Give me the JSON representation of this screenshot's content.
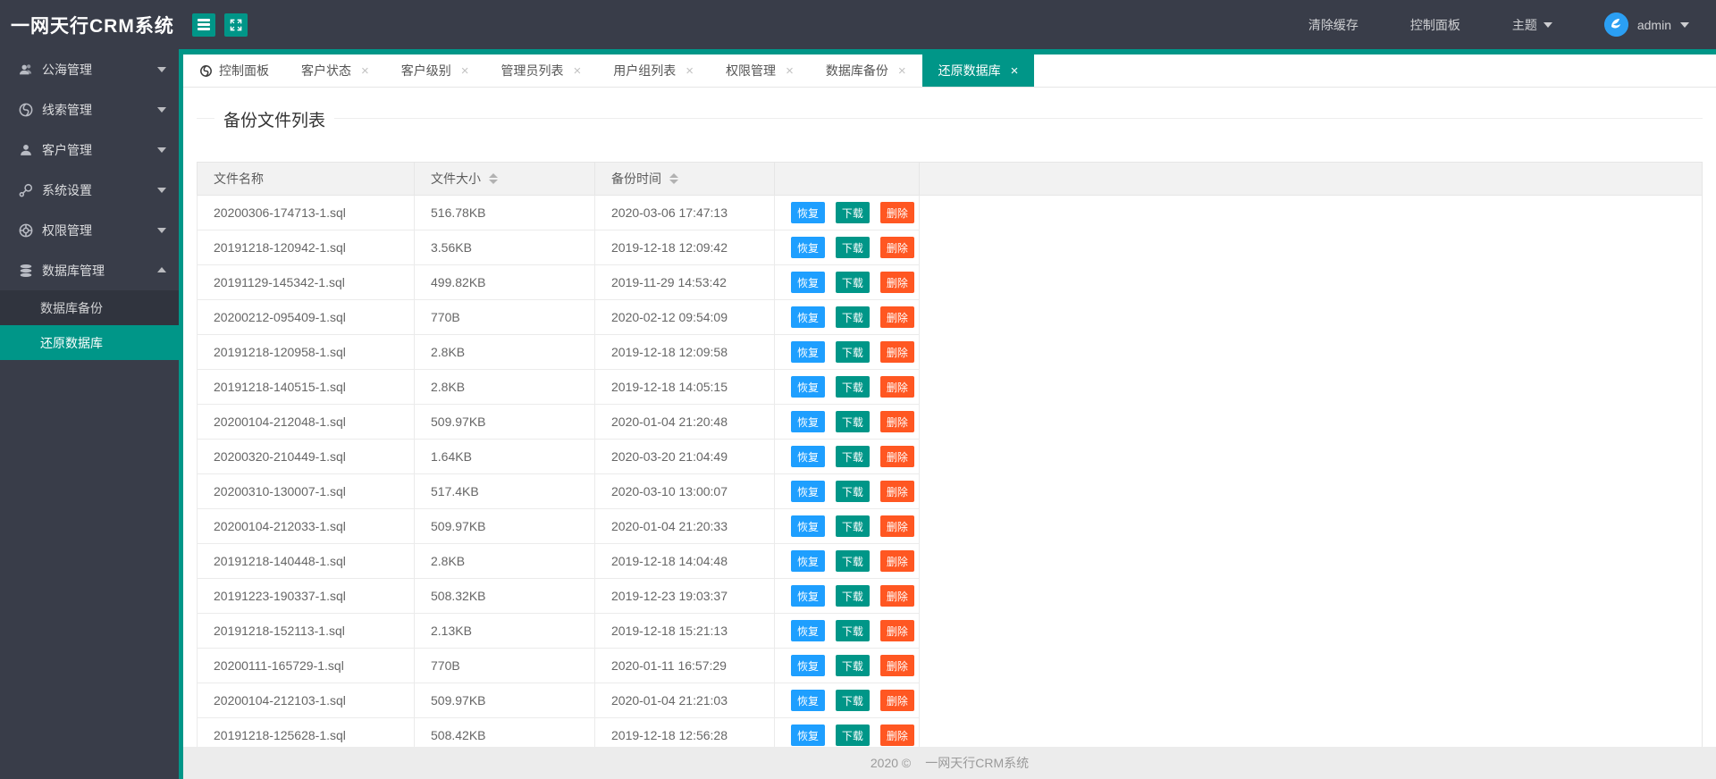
{
  "app": {
    "title": "一网天行CRM系统"
  },
  "header": {
    "menu_items": [
      "清除缓存",
      "控制面板"
    ],
    "theme_label": "主题",
    "username": "admin"
  },
  "sidebar": {
    "items": [
      {
        "label": "公海管理",
        "icon": "users-icon",
        "expanded": false
      },
      {
        "label": "线索管理",
        "icon": "globe-icon",
        "expanded": false
      },
      {
        "label": "客户管理",
        "icon": "user-icon",
        "expanded": false
      },
      {
        "label": "系统设置",
        "icon": "settings-icon",
        "expanded": false
      },
      {
        "label": "权限管理",
        "icon": "wheel-icon",
        "expanded": false
      },
      {
        "label": "数据库管理",
        "icon": "database-icon",
        "expanded": true,
        "children": [
          {
            "label": "数据库备份",
            "active": false
          },
          {
            "label": "还原数据库",
            "active": true
          }
        ]
      }
    ]
  },
  "tabs": [
    {
      "label": "控制面板",
      "has_icon": true,
      "closable": false,
      "active": false
    },
    {
      "label": "客户状态",
      "closable": true,
      "active": false
    },
    {
      "label": "客户级别",
      "closable": true,
      "active": false
    },
    {
      "label": "管理员列表",
      "closable": true,
      "active": false
    },
    {
      "label": "用户组列表",
      "closable": true,
      "active": false
    },
    {
      "label": "权限管理",
      "closable": true,
      "active": false
    },
    {
      "label": "数据库备份",
      "closable": true,
      "active": false
    },
    {
      "label": "还原数据库",
      "closable": true,
      "active": true
    }
  ],
  "page": {
    "section_title": "备份文件列表",
    "table": {
      "columns": [
        {
          "label": "文件名称",
          "sortable": false
        },
        {
          "label": "文件大小",
          "sortable": true
        },
        {
          "label": "备份时间",
          "sortable": true
        },
        {
          "label": "",
          "sortable": false
        }
      ],
      "row_actions": [
        {
          "label": "恢复",
          "color": "#1E9FFF"
        },
        {
          "label": "下载",
          "color": "#009688"
        },
        {
          "label": "删除",
          "color": "#FF5722"
        }
      ],
      "rows": [
        {
          "name": "20200306-174713-1.sql",
          "size": "516.78KB",
          "time": "2020-03-06 17:47:13"
        },
        {
          "name": "20191218-120942-1.sql",
          "size": "3.56KB",
          "time": "2019-12-18 12:09:42"
        },
        {
          "name": "20191129-145342-1.sql",
          "size": "499.82KB",
          "time": "2019-11-29 14:53:42"
        },
        {
          "name": "20200212-095409-1.sql",
          "size": "770B",
          "time": "2020-02-12 09:54:09"
        },
        {
          "name": "20191218-120958-1.sql",
          "size": "2.8KB",
          "time": "2019-12-18 12:09:58"
        },
        {
          "name": "20191218-140515-1.sql",
          "size": "2.8KB",
          "time": "2019-12-18 14:05:15"
        },
        {
          "name": "20200104-212048-1.sql",
          "size": "509.97KB",
          "time": "2020-01-04 21:20:48"
        },
        {
          "name": "20200320-210449-1.sql",
          "size": "1.64KB",
          "time": "2020-03-20 21:04:49"
        },
        {
          "name": "20200310-130007-1.sql",
          "size": "517.4KB",
          "time": "2020-03-10 13:00:07"
        },
        {
          "name": "20200104-212033-1.sql",
          "size": "509.97KB",
          "time": "2020-01-04 21:20:33"
        },
        {
          "name": "20191218-140448-1.sql",
          "size": "2.8KB",
          "time": "2019-12-18 14:04:48"
        },
        {
          "name": "20191223-190337-1.sql",
          "size": "508.32KB",
          "time": "2019-12-23 19:03:37"
        },
        {
          "name": "20191218-152113-1.sql",
          "size": "2.13KB",
          "time": "2019-12-18 15:21:13"
        },
        {
          "name": "20200111-165729-1.sql",
          "size": "770B",
          "time": "2020-01-11 16:57:29"
        },
        {
          "name": "20200104-212103-1.sql",
          "size": "509.97KB",
          "time": "2020-01-04 21:21:03"
        },
        {
          "name": "20191218-125628-1.sql",
          "size": "508.42KB",
          "time": "2019-12-18 12:56:28"
        }
      ]
    }
  },
  "footer": {
    "text": "2020 ©",
    "brand": "一网天行CRM系统"
  },
  "colors": {
    "accent": "#009688",
    "sidebar_bg": "#393D49",
    "submenu_bg": "#30343E",
    "restore_btn": "#1E9FFF",
    "download_btn": "#009688",
    "delete_btn": "#FF5722",
    "table_header_bg": "#f2f2f2",
    "footer_bg": "#ececec"
  }
}
